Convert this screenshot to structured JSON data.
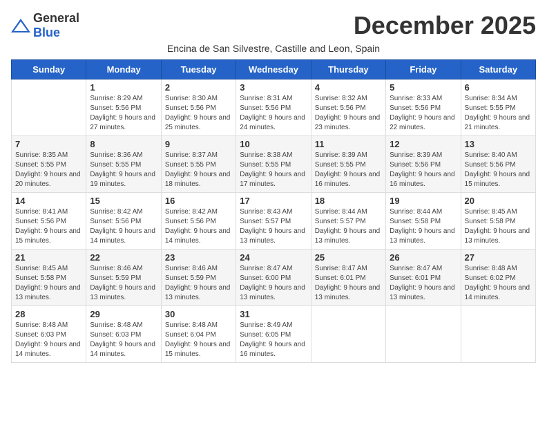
{
  "logo": {
    "general": "General",
    "blue": "Blue"
  },
  "title": "December 2025",
  "subtitle": "Encina de San Silvestre, Castille and Leon, Spain",
  "days_of_week": [
    "Sunday",
    "Monday",
    "Tuesday",
    "Wednesday",
    "Thursday",
    "Friday",
    "Saturday"
  ],
  "weeks": [
    [
      {
        "day": "",
        "sunrise": "",
        "sunset": "",
        "daylight": ""
      },
      {
        "day": "1",
        "sunrise": "Sunrise: 8:29 AM",
        "sunset": "Sunset: 5:56 PM",
        "daylight": "Daylight: 9 hours and 27 minutes."
      },
      {
        "day": "2",
        "sunrise": "Sunrise: 8:30 AM",
        "sunset": "Sunset: 5:56 PM",
        "daylight": "Daylight: 9 hours and 25 minutes."
      },
      {
        "day": "3",
        "sunrise": "Sunrise: 8:31 AM",
        "sunset": "Sunset: 5:56 PM",
        "daylight": "Daylight: 9 hours and 24 minutes."
      },
      {
        "day": "4",
        "sunrise": "Sunrise: 8:32 AM",
        "sunset": "Sunset: 5:56 PM",
        "daylight": "Daylight: 9 hours and 23 minutes."
      },
      {
        "day": "5",
        "sunrise": "Sunrise: 8:33 AM",
        "sunset": "Sunset: 5:56 PM",
        "daylight": "Daylight: 9 hours and 22 minutes."
      },
      {
        "day": "6",
        "sunrise": "Sunrise: 8:34 AM",
        "sunset": "Sunset: 5:55 PM",
        "daylight": "Daylight: 9 hours and 21 minutes."
      }
    ],
    [
      {
        "day": "7",
        "sunrise": "Sunrise: 8:35 AM",
        "sunset": "Sunset: 5:55 PM",
        "daylight": "Daylight: 9 hours and 20 minutes."
      },
      {
        "day": "8",
        "sunrise": "Sunrise: 8:36 AM",
        "sunset": "Sunset: 5:55 PM",
        "daylight": "Daylight: 9 hours and 19 minutes."
      },
      {
        "day": "9",
        "sunrise": "Sunrise: 8:37 AM",
        "sunset": "Sunset: 5:55 PM",
        "daylight": "Daylight: 9 hours and 18 minutes."
      },
      {
        "day": "10",
        "sunrise": "Sunrise: 8:38 AM",
        "sunset": "Sunset: 5:55 PM",
        "daylight": "Daylight: 9 hours and 17 minutes."
      },
      {
        "day": "11",
        "sunrise": "Sunrise: 8:39 AM",
        "sunset": "Sunset: 5:55 PM",
        "daylight": "Daylight: 9 hours and 16 minutes."
      },
      {
        "day": "12",
        "sunrise": "Sunrise: 8:39 AM",
        "sunset": "Sunset: 5:56 PM",
        "daylight": "Daylight: 9 hours and 16 minutes."
      },
      {
        "day": "13",
        "sunrise": "Sunrise: 8:40 AM",
        "sunset": "Sunset: 5:56 PM",
        "daylight": "Daylight: 9 hours and 15 minutes."
      }
    ],
    [
      {
        "day": "14",
        "sunrise": "Sunrise: 8:41 AM",
        "sunset": "Sunset: 5:56 PM",
        "daylight": "Daylight: 9 hours and 15 minutes."
      },
      {
        "day": "15",
        "sunrise": "Sunrise: 8:42 AM",
        "sunset": "Sunset: 5:56 PM",
        "daylight": "Daylight: 9 hours and 14 minutes."
      },
      {
        "day": "16",
        "sunrise": "Sunrise: 8:42 AM",
        "sunset": "Sunset: 5:56 PM",
        "daylight": "Daylight: 9 hours and 14 minutes."
      },
      {
        "day": "17",
        "sunrise": "Sunrise: 8:43 AM",
        "sunset": "Sunset: 5:57 PM",
        "daylight": "Daylight: 9 hours and 13 minutes."
      },
      {
        "day": "18",
        "sunrise": "Sunrise: 8:44 AM",
        "sunset": "Sunset: 5:57 PM",
        "daylight": "Daylight: 9 hours and 13 minutes."
      },
      {
        "day": "19",
        "sunrise": "Sunrise: 8:44 AM",
        "sunset": "Sunset: 5:58 PM",
        "daylight": "Daylight: 9 hours and 13 minutes."
      },
      {
        "day": "20",
        "sunrise": "Sunrise: 8:45 AM",
        "sunset": "Sunset: 5:58 PM",
        "daylight": "Daylight: 9 hours and 13 minutes."
      }
    ],
    [
      {
        "day": "21",
        "sunrise": "Sunrise: 8:45 AM",
        "sunset": "Sunset: 5:58 PM",
        "daylight": "Daylight: 9 hours and 13 minutes."
      },
      {
        "day": "22",
        "sunrise": "Sunrise: 8:46 AM",
        "sunset": "Sunset: 5:59 PM",
        "daylight": "Daylight: 9 hours and 13 minutes."
      },
      {
        "day": "23",
        "sunrise": "Sunrise: 8:46 AM",
        "sunset": "Sunset: 5:59 PM",
        "daylight": "Daylight: 9 hours and 13 minutes."
      },
      {
        "day": "24",
        "sunrise": "Sunrise: 8:47 AM",
        "sunset": "Sunset: 6:00 PM",
        "daylight": "Daylight: 9 hours and 13 minutes."
      },
      {
        "day": "25",
        "sunrise": "Sunrise: 8:47 AM",
        "sunset": "Sunset: 6:01 PM",
        "daylight": "Daylight: 9 hours and 13 minutes."
      },
      {
        "day": "26",
        "sunrise": "Sunrise: 8:47 AM",
        "sunset": "Sunset: 6:01 PM",
        "daylight": "Daylight: 9 hours and 13 minutes."
      },
      {
        "day": "27",
        "sunrise": "Sunrise: 8:48 AM",
        "sunset": "Sunset: 6:02 PM",
        "daylight": "Daylight: 9 hours and 14 minutes."
      }
    ],
    [
      {
        "day": "28",
        "sunrise": "Sunrise: 8:48 AM",
        "sunset": "Sunset: 6:03 PM",
        "daylight": "Daylight: 9 hours and 14 minutes."
      },
      {
        "day": "29",
        "sunrise": "Sunrise: 8:48 AM",
        "sunset": "Sunset: 6:03 PM",
        "daylight": "Daylight: 9 hours and 14 minutes."
      },
      {
        "day": "30",
        "sunrise": "Sunrise: 8:48 AM",
        "sunset": "Sunset: 6:04 PM",
        "daylight": "Daylight: 9 hours and 15 minutes."
      },
      {
        "day": "31",
        "sunrise": "Sunrise: 8:49 AM",
        "sunset": "Sunset: 6:05 PM",
        "daylight": "Daylight: 9 hours and 16 minutes."
      },
      {
        "day": "",
        "sunrise": "",
        "sunset": "",
        "daylight": ""
      },
      {
        "day": "",
        "sunrise": "",
        "sunset": "",
        "daylight": ""
      },
      {
        "day": "",
        "sunrise": "",
        "sunset": "",
        "daylight": ""
      }
    ]
  ]
}
